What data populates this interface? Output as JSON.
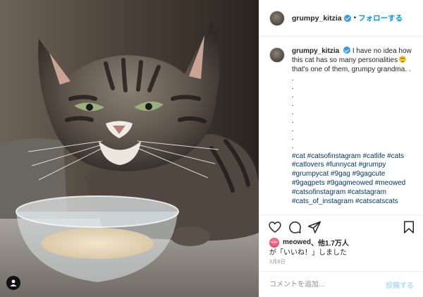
{
  "header": {
    "username": "grumpy_kitzia",
    "separator": "•",
    "follow_label": "フォローする",
    "verified_icon": "verified-badge-icon"
  },
  "caption": {
    "username": "grumpy_kitzia",
    "text": "I have no idea how this cat has so many personalities",
    "emoji": "rolling-on-floor-laughing",
    "text_after": "that's one of them, grumpy grandma. .",
    "dots": [
      ".",
      ".",
      ".",
      ".",
      ".",
      ".",
      ".",
      ".",
      "."
    ],
    "hashtags": "#cat #catsofinstagram #catlife #cats #catlovers #funnycat #grumpy #grumpycat #9gag #9gagcute #9gagpets #9gagmeowed #meowed #catsofinstagram #catstagram #cats_of_instagram #catscatscats"
  },
  "actions": {
    "icons": [
      "heart-icon",
      "comment-icon",
      "share-icon",
      "bookmark-icon"
    ]
  },
  "likes": {
    "user": "meowed",
    "others": "、他1.7万人",
    "line2": "が「いいね！」しました"
  },
  "date": "3月6日",
  "comment": {
    "placeholder": "コメントを追加...",
    "post_label": "投稿する"
  },
  "colors": {
    "link_blue": "#0095f6",
    "hashtag_blue": "#00376b",
    "verified_blue": "#3897f0",
    "post_button_disabled": "#b2dffc",
    "border": "#efefef",
    "muted": "#8e8e8e"
  }
}
